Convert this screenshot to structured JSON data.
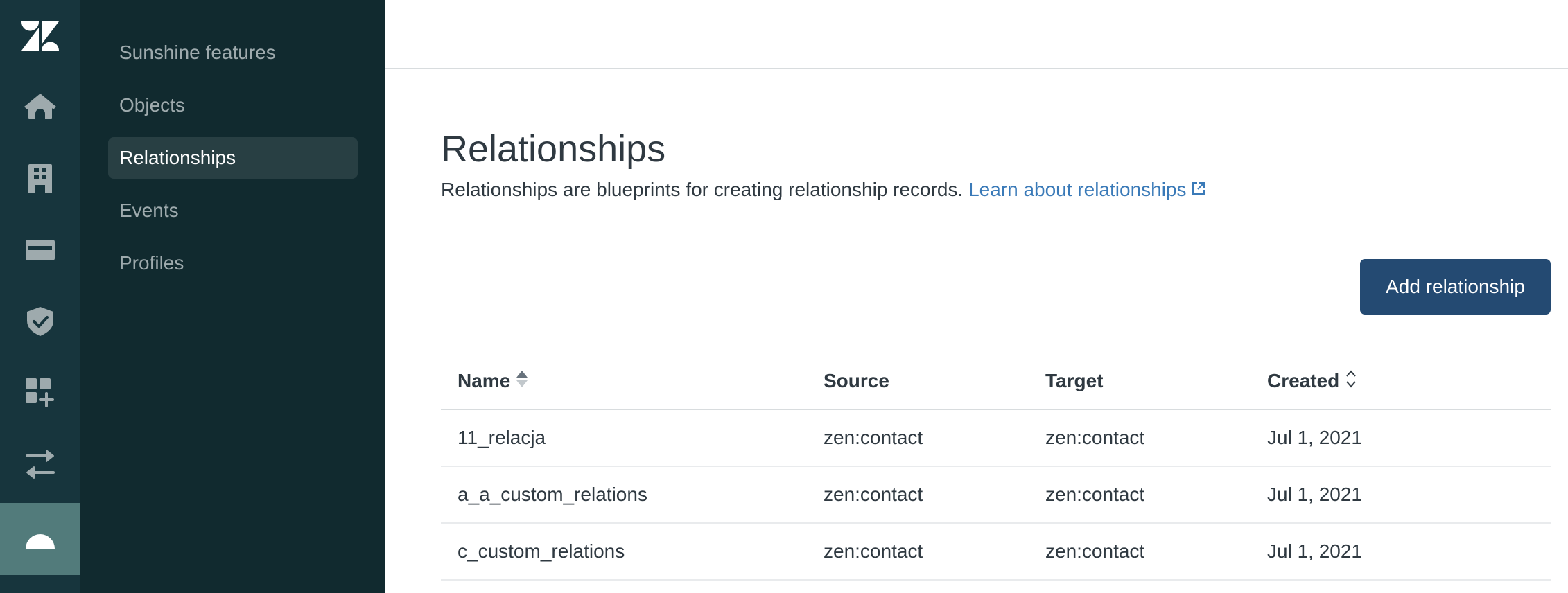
{
  "rail": {
    "items": [
      {
        "icon": "zendesk-logo-icon",
        "active": false
      },
      {
        "icon": "home-icon",
        "active": false
      },
      {
        "icon": "building-icon",
        "active": false
      },
      {
        "icon": "card-icon",
        "active": false
      },
      {
        "icon": "shield-check-icon",
        "active": false
      },
      {
        "icon": "apps-add-icon",
        "active": false
      },
      {
        "icon": "arrows-swap-icon",
        "active": false
      },
      {
        "icon": "sunshine-icon",
        "active": true
      }
    ]
  },
  "subnav": {
    "items": [
      {
        "label": "Sunshine features",
        "active": false
      },
      {
        "label": "Objects",
        "active": false
      },
      {
        "label": "Relationships",
        "active": true
      },
      {
        "label": "Events",
        "active": false
      },
      {
        "label": "Profiles",
        "active": false
      }
    ]
  },
  "page": {
    "title": "Relationships",
    "description": "Relationships are blueprints for creating relationship records.",
    "learn_link": "Learn about relationships",
    "learn_link_icon": "external-link-icon",
    "add_button": "Add relationship"
  },
  "table": {
    "columns": [
      {
        "label": "Name",
        "sort": "ascending"
      },
      {
        "label": "Source",
        "sort": null
      },
      {
        "label": "Target",
        "sort": null
      },
      {
        "label": "Created",
        "sort": "sortable"
      }
    ],
    "rows": [
      {
        "name": "11_relacja",
        "source": "zen:contact",
        "target": "zen:contact",
        "created": "Jul 1, 2021"
      },
      {
        "name": "a_a_custom_relations",
        "source": "zen:contact",
        "target": "zen:contact",
        "created": "Jul 1, 2021"
      },
      {
        "name": "c_custom_relations",
        "source": "zen:contact",
        "target": "zen:contact",
        "created": "Jul 1, 2021"
      }
    ]
  },
  "colors": {
    "rail_bg": "#17353d",
    "rail_active": "#527b7b",
    "subnav_bg": "#112a2f",
    "subnav_active": "#283f43",
    "primary_button": "#244a72",
    "link": "#3a7ab8",
    "text": "#2f3941"
  }
}
